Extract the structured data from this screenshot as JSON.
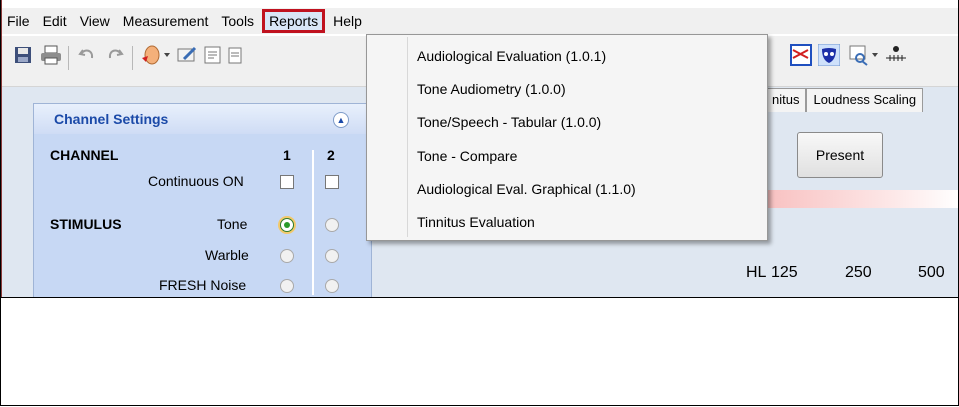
{
  "menubar": {
    "items": [
      "File",
      "Edit",
      "View",
      "Measurement",
      "Tools",
      "Reports",
      "Help"
    ]
  },
  "reports_menu": {
    "items": [
      "Audiological Evaluation (1.0.1)",
      "Tone Audiometry (1.0.0)",
      "Tone/Speech - Tabular (1.0.0)",
      "Tone - Compare",
      "Audiological Eval. Graphical (1.1.0)",
      "Tinnitus Evaluation"
    ]
  },
  "tabs": [
    "nitus",
    "Loudness Scaling"
  ],
  "channel_settings": {
    "title": "Channel Settings",
    "channel_label": "CHANNEL",
    "col1": "1",
    "col2": "2",
    "continuous": "Continuous ON",
    "stimulus_label": "STIMULUS",
    "stimuli": [
      "Tone",
      "Warble",
      "FRESH Noise"
    ]
  },
  "present_button": "Present",
  "audiogram": {
    "hl_label": "HL",
    "freqs": [
      "125",
      "250",
      "500"
    ]
  },
  "colors": {
    "highlight": "#c0121f",
    "panel": "#c7d8f4",
    "panel_title": "#1b4aa8"
  }
}
